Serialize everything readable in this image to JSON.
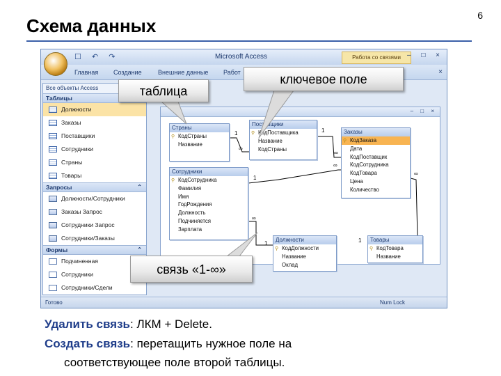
{
  "slide": {
    "title": "Схема данных",
    "page_number": "6"
  },
  "window": {
    "app_title": "Microsoft Access",
    "context_tab": "Работа со связями",
    "qat": "☐ ↶ ↷",
    "controls": "– □ ×"
  },
  "ribbon": {
    "tabs": [
      "Главная",
      "Создание",
      "Внешние данные",
      "Работ"
    ],
    "close": "×"
  },
  "nav": {
    "header": "Все объекты Access",
    "groups": [
      {
        "label": "Таблицы",
        "items": [
          "Должности",
          "Заказы",
          "Поставщики",
          "Сотрудники",
          "Страны",
          "Товары"
        ]
      },
      {
        "label": "Запросы",
        "items": [
          "Должности/Сотрудники",
          "Заказы Запрос",
          "Сотрудники Запрос",
          "Сотрудники/Заказы"
        ]
      },
      {
        "label": "Формы",
        "items": [
          "Подчиненная",
          "Сотрудники",
          "Сотрудники/Сдели"
        ]
      }
    ]
  },
  "tables": {
    "strany": {
      "title": "Страны",
      "fields": [
        "КодСтраны",
        "Название"
      ]
    },
    "postavshiki": {
      "title": "Поставщики",
      "fields": [
        "КодПоставщика",
        "Название",
        "КодСтраны"
      ]
    },
    "zakazy": {
      "title": "Заказы",
      "fields": [
        "КодЗаказа",
        "Дата",
        "КодПоставщик",
        "КодСотрудника",
        "КодТовара",
        "Цена",
        "Количество"
      ]
    },
    "sotrudniki": {
      "title": "Сотрудники",
      "fields": [
        "КодСотрудника",
        "Фамилия",
        "Имя",
        "ГодРождения",
        "Должность",
        "Подчиняется",
        "Зарплата"
      ]
    },
    "dolzhnosti": {
      "title": "Должности",
      "fields": [
        "КодДолжности",
        "Название",
        "Оклад"
      ]
    },
    "tovary": {
      "title": "Товары",
      "fields": [
        "КодТовара",
        "Название"
      ]
    }
  },
  "relation_marks": {
    "one": "1",
    "many": "∞"
  },
  "status": {
    "left": "Готово",
    "right": "Num Lock"
  },
  "callouts": {
    "table": "таблица",
    "key_field": "ключевое поле",
    "link": "связь «1-∞»"
  },
  "captions": {
    "delete_label": "Удалить связь",
    "delete_text": ": ЛКМ + Delete.",
    "create_label": "Создать связь",
    "create_text": ": перетащить нужное поле на",
    "create_text2": "соответствующее поле второй таблицы."
  },
  "colors": {
    "accent": "#1f3d8a",
    "key_highlight": "#f8b452",
    "selected_nav": "#fbe3a6"
  }
}
